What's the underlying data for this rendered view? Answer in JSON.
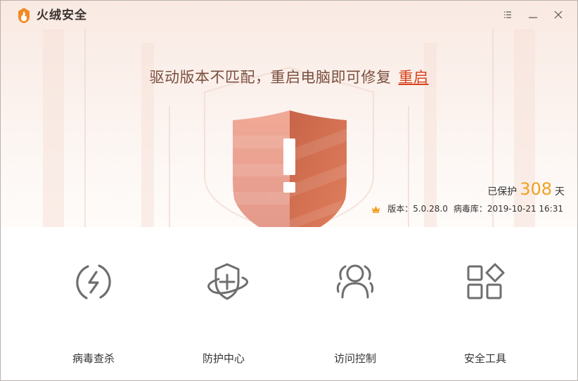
{
  "app": {
    "title": "火绒安全"
  },
  "status": {
    "message": "驱动版本不匹配，重启电脑即可修复",
    "action_label": "重启"
  },
  "protection": {
    "prefix": "已保护",
    "days": "308",
    "suffix": "天"
  },
  "version_info": {
    "version_label": "版本：5.0.28.0",
    "virus_db_label": "病毒库：2019-10-21 16:31"
  },
  "tiles": [
    {
      "label": "病毒查杀",
      "icon": "lightning-circle-icon"
    },
    {
      "label": "防护中心",
      "icon": "shield-orbit-icon"
    },
    {
      "label": "访问控制",
      "icon": "users-icon"
    },
    {
      "label": "安全工具",
      "icon": "app-grid-icon"
    }
  ],
  "colors": {
    "accent": "#d9431c",
    "days_highlight": "#f2a020",
    "shield_left": "#eea08a",
    "shield_right": "#d8704f"
  }
}
